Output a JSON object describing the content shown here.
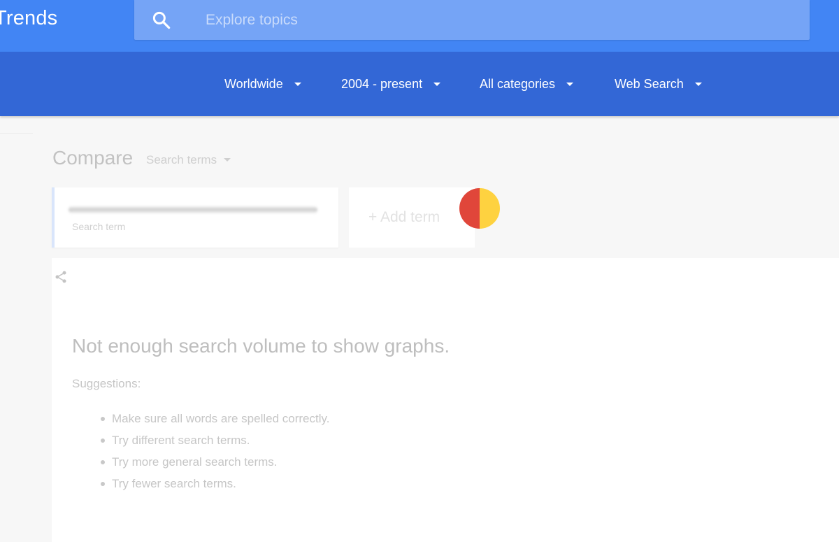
{
  "header": {
    "brand": "Trends",
    "search": {
      "placeholder": "Explore topics",
      "icon": "search-icon"
    }
  },
  "filters": {
    "location": "Worldwide",
    "time_range": "2004 - present",
    "category": "All categories",
    "property": "Web Search"
  },
  "compare": {
    "title": "Compare",
    "mode": "Search terms",
    "term_card": {
      "caption": "Search term",
      "dot_colors": [
        "#e0463a",
        "#fed240"
      ]
    },
    "add_term_label": "+ Add term"
  },
  "result": {
    "message": "Not enough search volume to show graphs.",
    "suggestions_label": "Suggestions:",
    "suggestions": [
      "Make sure all words are spelled correctly.",
      "Try different search terms.",
      "Try more general search terms.",
      "Try fewer search terms."
    ]
  },
  "colors": {
    "topbar": "#4285f4",
    "filterbar": "#3367d6",
    "search_box": "#75a4f6"
  }
}
